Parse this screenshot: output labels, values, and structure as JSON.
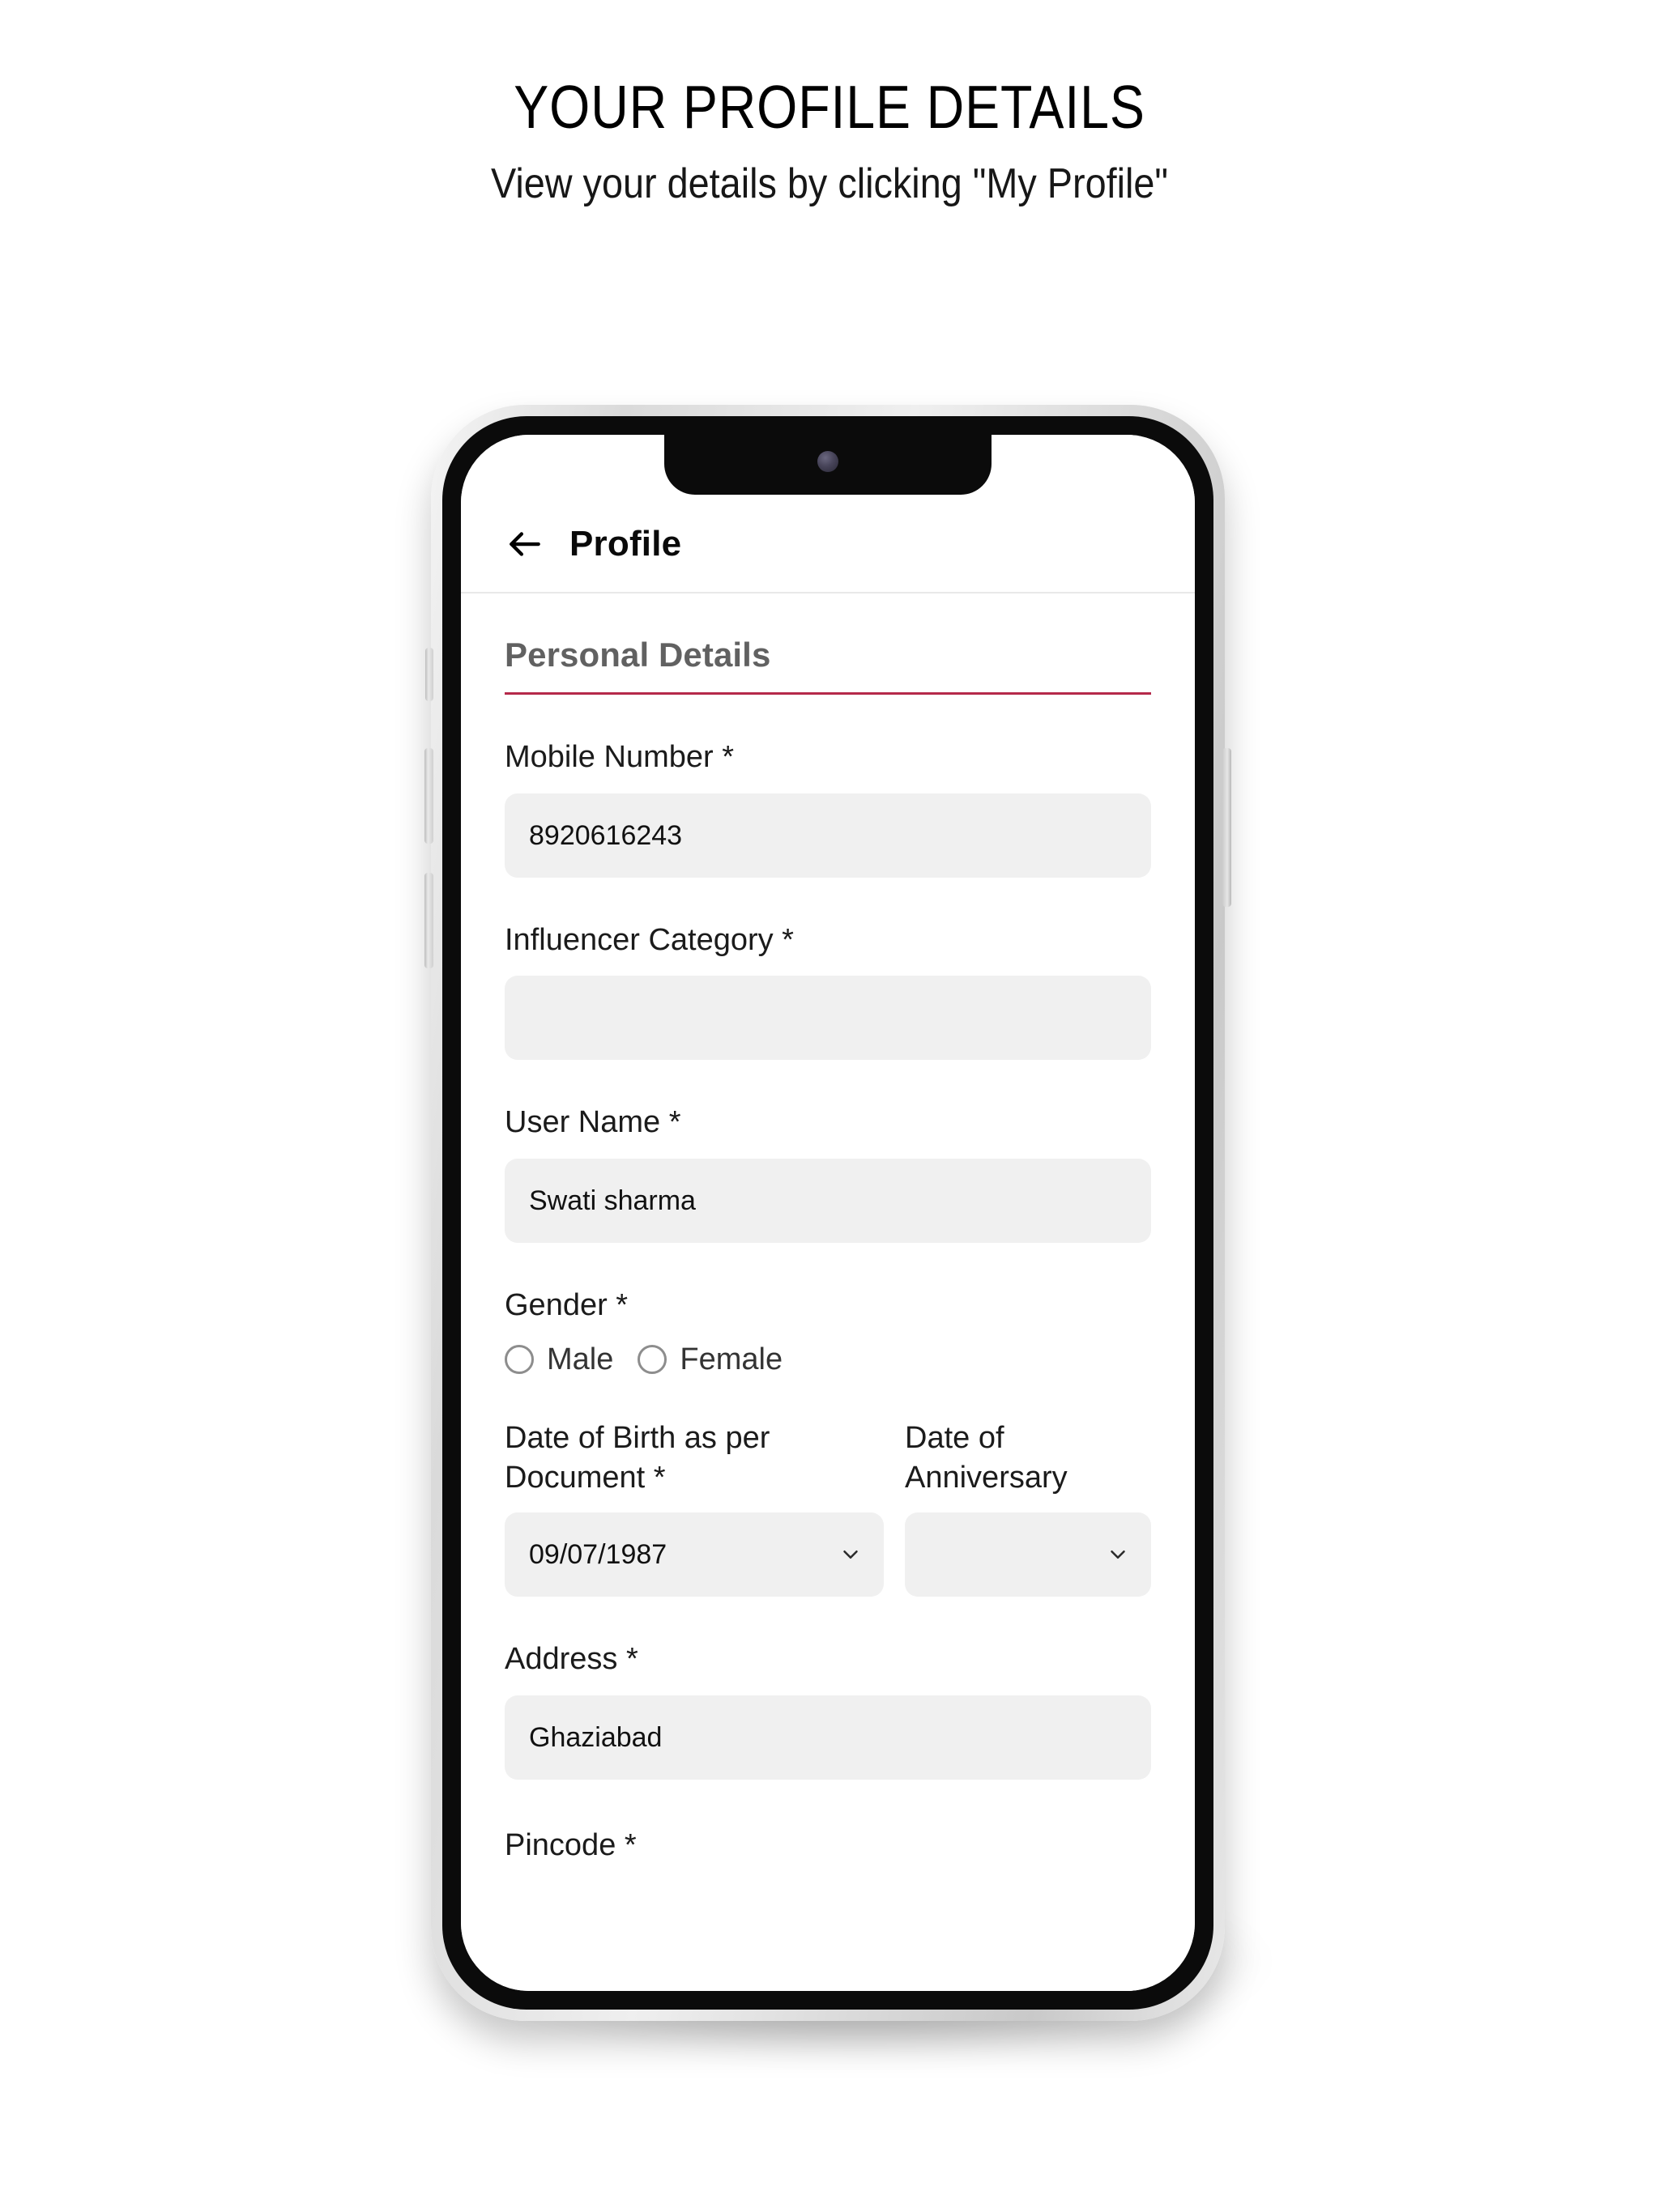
{
  "promo": {
    "title": "YOUR PROFILE DETAILS",
    "subtitle": "View your details by clicking \"My Profile\""
  },
  "phone": {
    "appbar": {
      "back_icon": "arrow-left-icon",
      "title": "Profile"
    },
    "section": {
      "title": "Personal Details",
      "accent_color": "#b5294a"
    },
    "fields": {
      "mobile": {
        "label": "Mobile Number *",
        "value": "8920616243",
        "placeholder": ""
      },
      "influencer_category": {
        "label": "Influencer Category *",
        "value": "",
        "placeholder": ""
      },
      "user_name": {
        "label": "User Name *",
        "value": "Swati sharma",
        "placeholder": ""
      },
      "gender": {
        "label": "Gender *",
        "options": [
          {
            "label": "Male",
            "selected": false
          },
          {
            "label": "Female",
            "selected": false
          }
        ]
      },
      "dob": {
        "label": "Date of Birth as per Document *",
        "value": "09/07/1987",
        "icon": "chevron-down-icon"
      },
      "anniversary": {
        "label": "Date of Anniversary",
        "value": "",
        "icon": "chevron-down-icon"
      },
      "address": {
        "label": "Address *",
        "value": "Ghaziabad",
        "placeholder": ""
      },
      "pincode": {
        "label": "Pincode *"
      }
    }
  }
}
